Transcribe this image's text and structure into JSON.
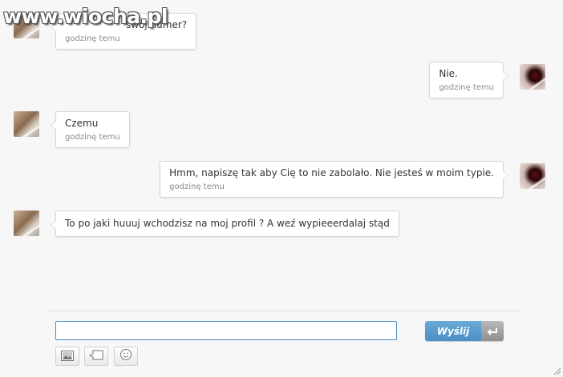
{
  "watermark": "www.wiocha.pl",
  "messages": [
    {
      "side": "left",
      "text": "swój numer?",
      "time": "godzinę temu"
    },
    {
      "side": "right",
      "text": "Nie.",
      "time": "godzinę temu"
    },
    {
      "side": "left",
      "text": "Czemu",
      "time": "godzinę temu"
    },
    {
      "side": "right",
      "text": "Hmm, napiszę tak aby Cię to nie zabolało. Nie jesteś w moim typie.",
      "time": "godzinę temu"
    },
    {
      "side": "left",
      "text": "To po jaki huuuj wchodzisz na moj profil ? A weź wypieeerdalaj stąd"
    }
  ],
  "composer": {
    "value": "",
    "send_label": "Wyślij",
    "send_icon": "enter-arrow-icon"
  },
  "toolbar": {
    "icons": [
      "image-icon",
      "speech-bubble-icon",
      "smiley-icon"
    ]
  },
  "colors": {
    "send_button": "#4a8ec4",
    "input_border": "#4a8cc4"
  }
}
